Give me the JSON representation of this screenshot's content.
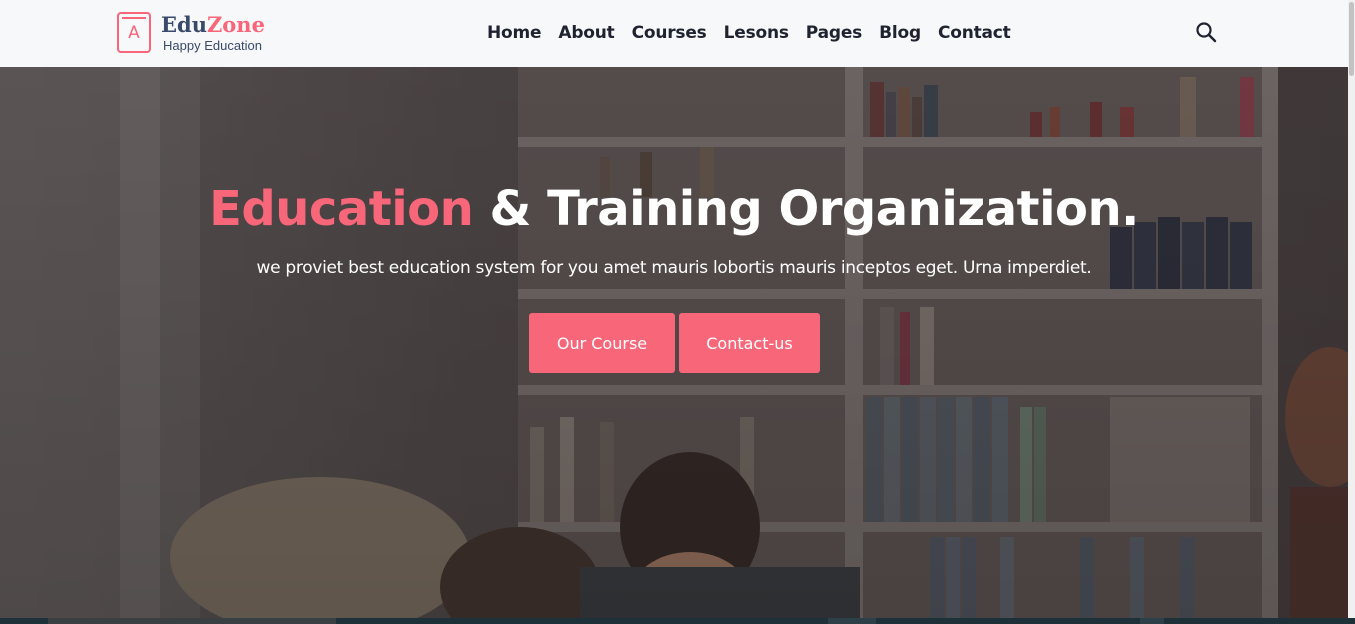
{
  "brand": {
    "letter": "A",
    "name_part1": "Edu",
    "name_part2": "Zone",
    "tagline": "Happy Education",
    "accent_color": "#f8667a",
    "text_color": "#3a4a6b"
  },
  "nav": {
    "items": [
      {
        "label": "Home"
      },
      {
        "label": "About"
      },
      {
        "label": "Courses"
      },
      {
        "label": "Lesons"
      },
      {
        "label": "Pages"
      },
      {
        "label": "Blog"
      },
      {
        "label": "Contact"
      }
    ],
    "search_icon": "search-icon"
  },
  "hero": {
    "title_accent": "Education",
    "title_rest": " & Training Organization.",
    "subtitle": "we proviet best education system for you amet mauris lobortis mauris inceptos eget. Urna imperdiet.",
    "primary_button": "Our Course",
    "secondary_button": "Contact-us",
    "button_color": "#f8667a"
  }
}
